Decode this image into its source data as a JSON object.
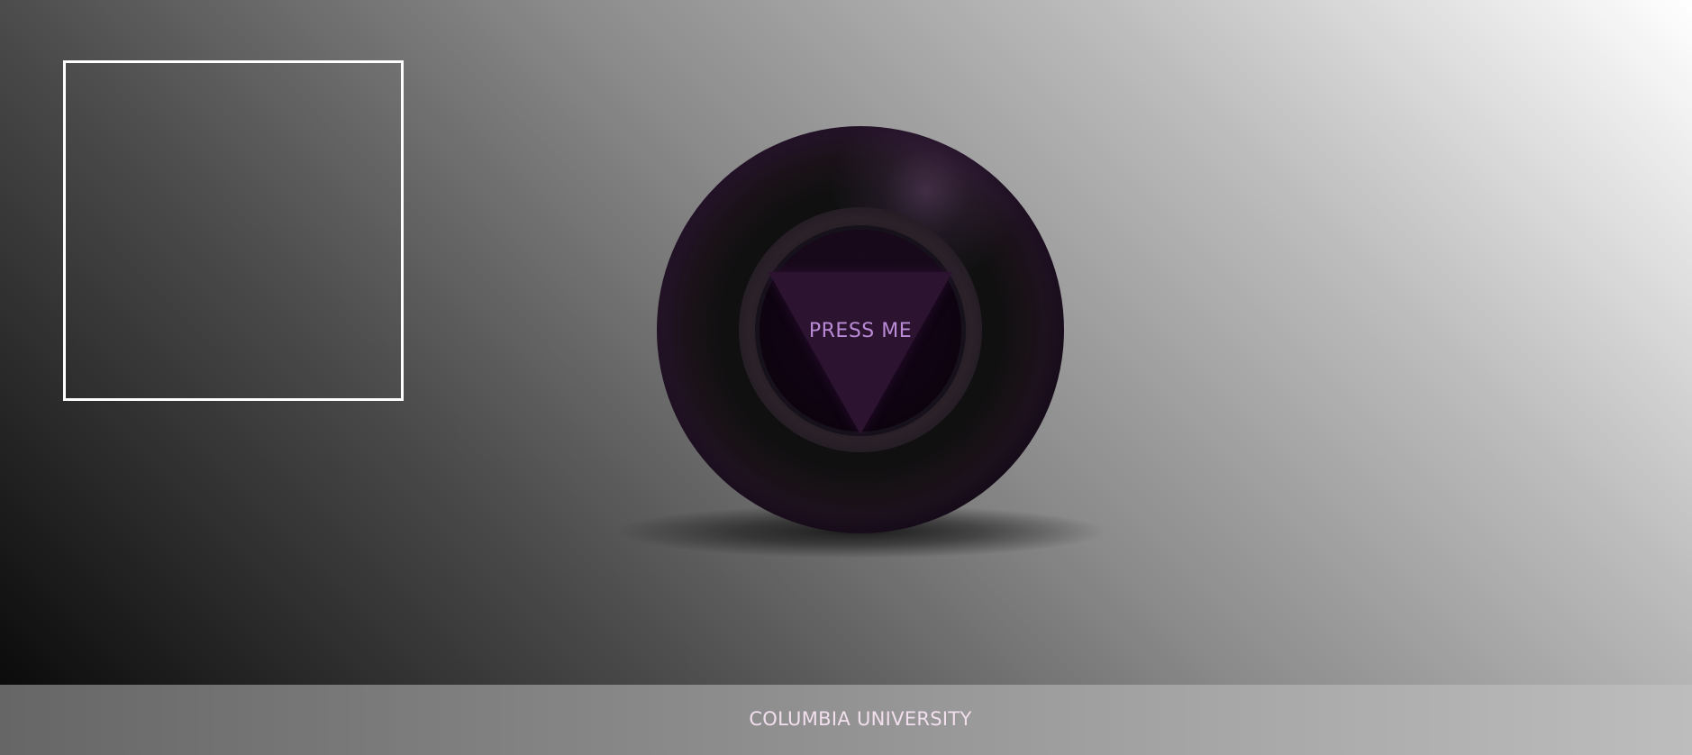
{
  "ball": {
    "prompt_label": "PRESS ME"
  },
  "footer": {
    "label": "COLUMBIA UNIVERSITY"
  },
  "colors": {
    "ball_rim": "#571f66",
    "prompt_text": "#b98bd6",
    "footer_text": "#f2dfee",
    "frame_border": "#ffffff"
  }
}
